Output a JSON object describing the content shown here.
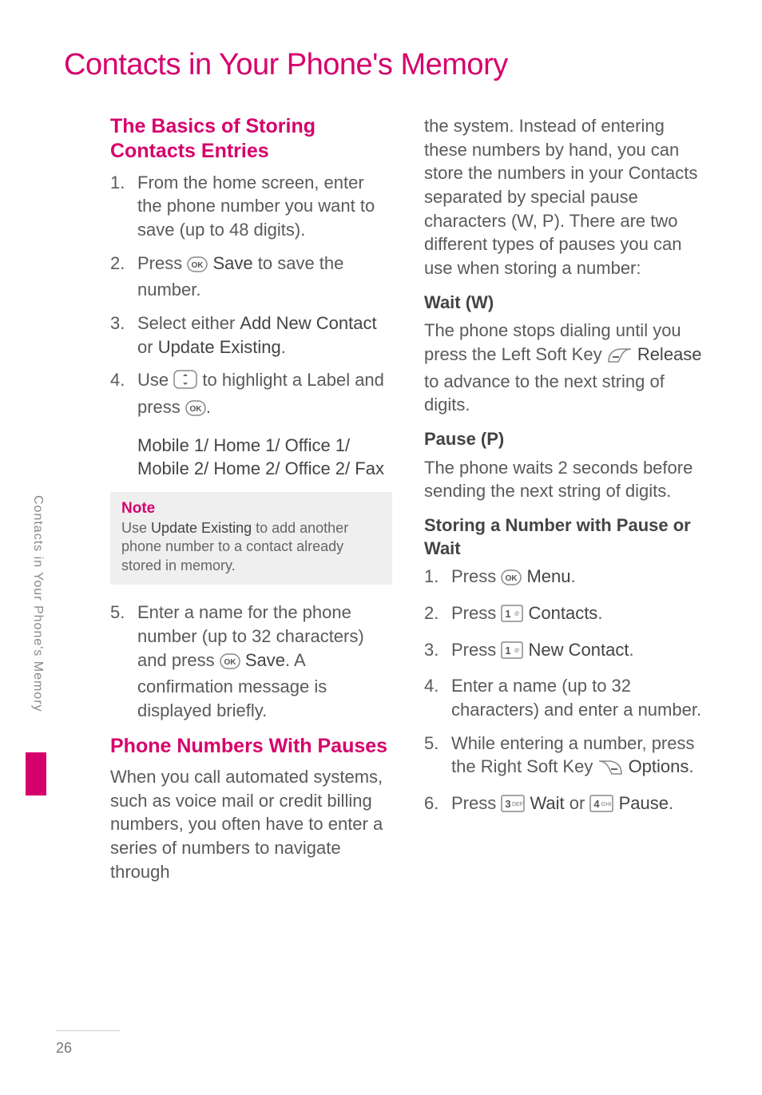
{
  "page_number": "26",
  "sidebar_label": "Contacts in Your Phone's Memory",
  "page_title": "Contacts in Your Phone's Memory",
  "colors": {
    "accent": "#d6006c"
  },
  "left": {
    "basics_heading": "The Basics of Storing Contacts Entries",
    "basics_steps": {
      "s1": "From the home screen, enter the phone number you want to save (up to 48 digits).",
      "s2a": "Press ",
      "s2_bold": "Save",
      "s2b": " to save the number.",
      "s3a": "Select either ",
      "s3_bold1": "Add New Contact",
      "s3_mid": " or ",
      "s3_bold2": "Update Existing",
      "s3b": ".",
      "s4a": "Use ",
      "s4b": " to highlight a Label and press ",
      "s4c": "."
    },
    "labels_list": "Mobile 1/ Home 1/ Office 1/ Mobile 2/ Home 2/ Office 2/ Fax",
    "note_title": "Note",
    "note_a": "Use ",
    "note_bold": "Update Existing",
    "note_b": " to add another phone number to a contact already stored in memory.",
    "step5a": "Enter a name for the phone number (up to 32 characters) and press ",
    "step5_bold": "Save",
    "step5b": ". A confirmation message is displayed briefly.",
    "pauses_heading": "Phone Numbers With Pauses",
    "pauses_intro": "When you call automated systems, such as voice mail or credit billing numbers, you often have to enter a series of numbers to navigate through"
  },
  "right": {
    "pauses_cont": "the system. Instead of entering these numbers by hand, you can store the numbers in your Contacts separated by special pause characters (W, P). There are two different types of pauses you can use when storing a number:",
    "wait_heading": "Wait (W)",
    "wait_a": "The phone stops dialing until you press the Left Soft Key ",
    "wait_bold": "Release",
    "wait_b": " to advance to the next string of digits.",
    "pause_heading": "Pause (P)",
    "pause_body": "The phone waits 2 seconds before sending the next string of digits.",
    "storing_heading": "Storing a Number with Pause or Wait",
    "storing_steps": {
      "s1a": "Press ",
      "s1_bold": "Menu",
      "s1b": ".",
      "s2a": "Press ",
      "s2_bold": "Contacts",
      "s2b": ".",
      "s3a": "Press ",
      "s3_bold": "New Contact",
      "s3b": ".",
      "s4": "Enter a name (up to 32 characters) and enter a number.",
      "s5a": "While entering a number, press the Right Soft Key ",
      "s5_bold": "Options",
      "s5b": ".",
      "s6a": "Press ",
      "s6_bold1": "Wait",
      "s6_mid": " or ",
      "s6_bold2": "Pause",
      "s6b": "."
    }
  },
  "icons": {
    "ok": "ok-key-icon",
    "nav": "nav-key-icon",
    "softleft": "left-soft-key-icon",
    "softright": "right-soft-key-icon",
    "key1": "keypad-1-icon",
    "key3": "keypad-3-icon",
    "key4": "keypad-4-icon"
  }
}
